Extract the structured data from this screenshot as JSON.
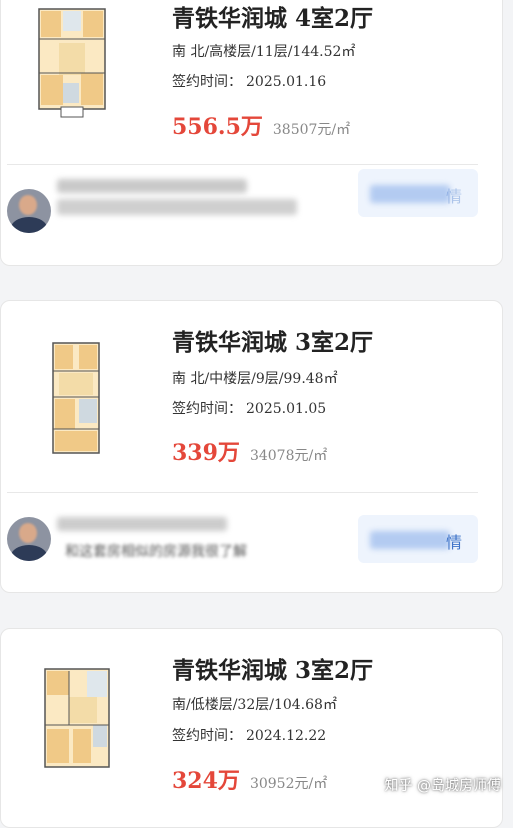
{
  "listings": [
    {
      "title": "青铁华润城 4室2厅",
      "meta": "南 北/高楼层/11层/144.52㎡",
      "sign_label": "签约时间：",
      "sign_date": "2025.01.16",
      "price": "556.5万",
      "unit_price": "38507元/㎡",
      "agent_text": "",
      "detail_label": "情"
    },
    {
      "title": "青铁华润城 3室2厅",
      "meta": "南 北/中楼层/9层/99.48㎡",
      "sign_label": "签约时间：",
      "sign_date": "2025.01.05",
      "price": "339万",
      "unit_price": "34078元/㎡",
      "agent_text": "和这套房相似的房源我很了解",
      "detail_label": "情"
    },
    {
      "title": "青铁华润城 3室2厅",
      "meta": "南/低楼层/32层/104.68㎡",
      "sign_label": "签约时间：",
      "sign_date": "2024.12.22",
      "price": "324万",
      "unit_price": "30952元/㎡"
    }
  ],
  "watermark": "知乎 @岛城房师傅",
  "colors": {
    "price": "#e4473a",
    "detail_button_bg": "#eef4fd",
    "detail_button_text": "#3f74c9"
  },
  "icons": [
    "floor-plan-image",
    "agent-avatar"
  ]
}
